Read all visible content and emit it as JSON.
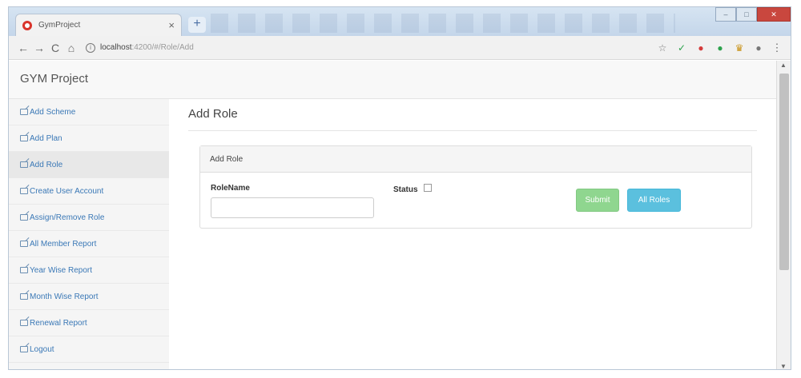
{
  "browser": {
    "tab_title": "GymProject",
    "tab_close": "×",
    "new_tab": "+",
    "url_host": "localhost",
    "url_path": ":4200/#/Role/Add",
    "back": "←",
    "forward": "→",
    "reload": "C",
    "home": "⌂",
    "info": "i",
    "star": "☆",
    "extensions": [
      "✓",
      "●",
      "●",
      "♛",
      "●"
    ],
    "menu": "⋮",
    "window_controls": [
      "–",
      "□",
      "✕"
    ]
  },
  "app": {
    "brand": "GYM Project",
    "sidebar": {
      "items": [
        {
          "label": "Add Scheme"
        },
        {
          "label": "Add Plan"
        },
        {
          "label": "Add Role"
        },
        {
          "label": "Create User Account"
        },
        {
          "label": "Assign/Remove Role"
        },
        {
          "label": "All Member Report"
        },
        {
          "label": "Year Wise Report"
        },
        {
          "label": "Month Wise Report"
        },
        {
          "label": "Renewal Report"
        },
        {
          "label": "Logout"
        }
      ],
      "active_index": 2
    },
    "page_title": "Add Role",
    "panel": {
      "heading": "Add Role",
      "rolename_label": "RoleName",
      "rolename_value": "",
      "status_label": "Status",
      "submit_label": "Submit",
      "all_roles_label": "All Roles"
    }
  },
  "colors": {
    "link": "#3a78b6",
    "submit": "#8fd68f",
    "all_roles": "#5bc0de"
  }
}
